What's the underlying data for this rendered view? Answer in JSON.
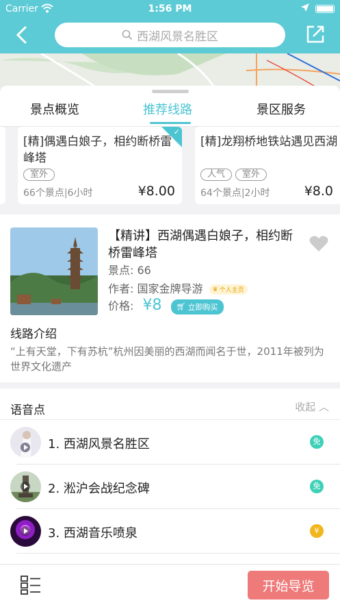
{
  "status_bar": {
    "carrier": "Carrier",
    "time": "1:56 PM"
  },
  "nav": {
    "search_placeholder": "西湖风景名胜区"
  },
  "tabs": [
    {
      "label": "景点概览"
    },
    {
      "label": "推荐线路"
    },
    {
      "label": "景区服务"
    }
  ],
  "route_cards": [
    {
      "title": "[精]偶遇白娘子，相约断桥雷峰塔",
      "tags": [
        "室外"
      ],
      "meta": "66个景点|6小时",
      "price": "¥8.00",
      "selected": true
    },
    {
      "title": "[精]龙翔桥地铁站遇见西湖",
      "tags": [
        "人气",
        "室外"
      ],
      "meta": "64个景点|2小时",
      "price": "¥8.0"
    }
  ],
  "detail": {
    "title": "【精讲】西湖偶遇白娘子，相约断桥雷峰塔",
    "spots_label": "景点: 66",
    "author_label": "作者: 国家金牌导游",
    "author_badge": "个人主页",
    "price_label": "价格:",
    "price_value": "¥8",
    "buy_label": "立即购买",
    "intro_heading": "线路介绍",
    "intro_text": "“上有天堂，下有苏杭”杭州因美丽的西湖而闻名于世，2011年被列为世界文化遗产"
  },
  "voice": {
    "heading": "语音点",
    "collapse_label": "收起",
    "items": [
      {
        "name": "1. 西湖风景名胜区",
        "badge": "免",
        "badge_color": "#3fd0b8"
      },
      {
        "name": "2. 淞沪会战纪念碑",
        "badge": "免",
        "badge_color": "#3fd0b8"
      },
      {
        "name": "3. 西湖音乐喷泉",
        "badge": "¥",
        "badge_color": "#f2b61d"
      }
    ]
  },
  "bottom": {
    "start_label": "开始导览"
  },
  "colors": {
    "accent": "#4cc4d2",
    "header": "#5ccbd6",
    "start_button": "#ef7a7a"
  }
}
